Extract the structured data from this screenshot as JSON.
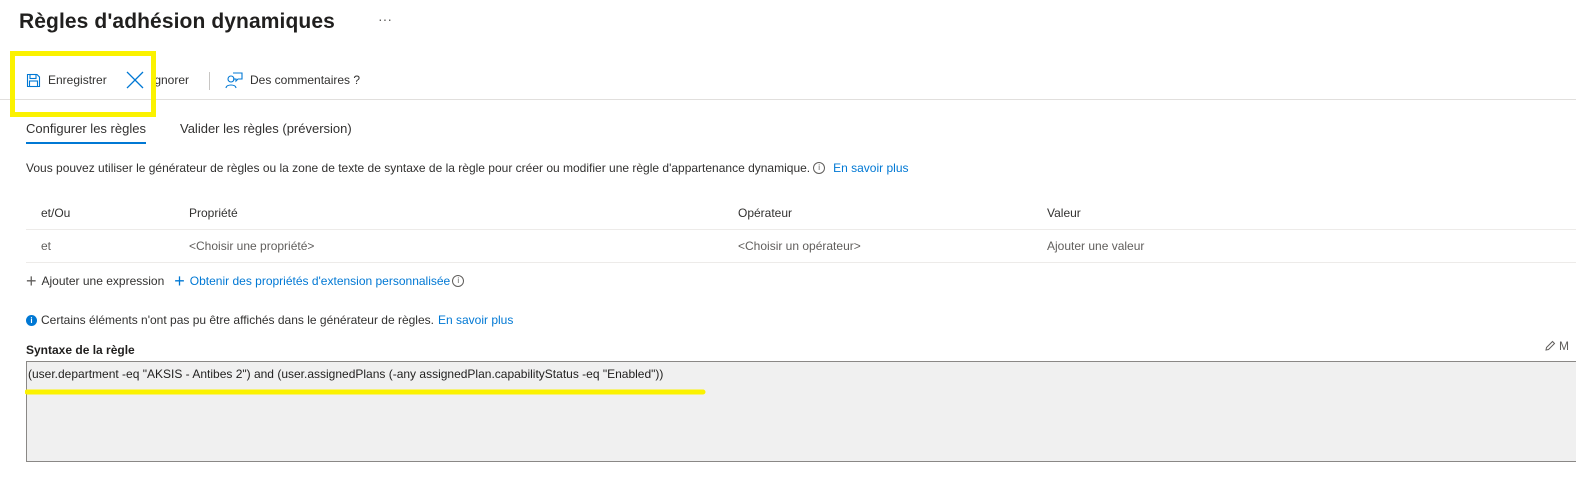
{
  "page": {
    "title": "Règles d'adhésion dynamiques",
    "more": "···"
  },
  "toolbar": {
    "save_label": "Enregistrer",
    "discard_label": "Ignorer",
    "feedback_label": "Des commentaires ?"
  },
  "tabs": [
    {
      "label": "Configurer les règles",
      "active": true
    },
    {
      "label": "Valider les règles (préversion)",
      "active": false
    }
  ],
  "description": {
    "text": "Vous pouvez utiliser le générateur de règles ou la zone de texte de syntaxe de la règle pour créer ou modifier une règle d'appartenance dynamique.",
    "link": "En savoir plus"
  },
  "rule_table": {
    "headers": [
      "et/Ou",
      "Propriété",
      "Opérateur",
      "Valeur"
    ],
    "rows": [
      [
        "et",
        "<Choisir une propriété>",
        "<Choisir un opérateur>",
        "Ajouter une valeur"
      ]
    ]
  },
  "actions": {
    "add_expression": "Ajouter une expression",
    "get_extension": "Obtenir des propriétés d'extension personnalisée"
  },
  "notice": {
    "text": "Certains éléments n'ont pas pu être affichés dans le générateur de règles.",
    "link": "En savoir plus"
  },
  "syntax": {
    "label": "Syntaxe de la règle",
    "edit_label": "M",
    "value": "(user.department -eq \"AKSIS - Antibes 2\") and (user.assignedPlans (-any assignedPlan.capabilityStatus -eq \"Enabled\"))"
  },
  "colors": {
    "accent": "#0078d4",
    "highlight": "#fbf200"
  }
}
